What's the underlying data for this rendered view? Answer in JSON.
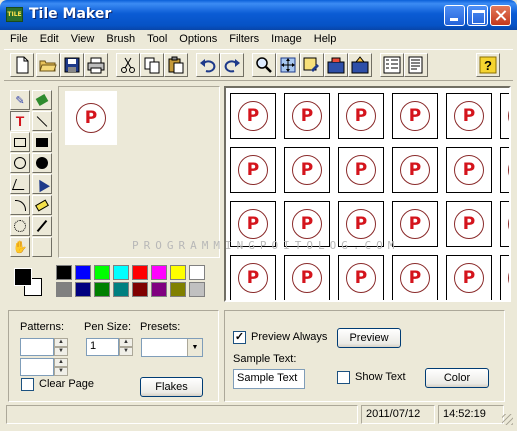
{
  "window": {
    "title": "Tile Maker",
    "icon_text": "TILE"
  },
  "menu": [
    "File",
    "Edit",
    "View",
    "Brush",
    "Tool",
    "Options",
    "Filters",
    "Image",
    "Help"
  ],
  "toolbar_icons": [
    "new-file-icon",
    "open-folder-icon",
    "save-icon",
    "print-icon",
    "cut-icon",
    "copy-icon",
    "paste-icon",
    "undo-icon",
    "redo-icon",
    "zoom-icon",
    "move-icon",
    "tile-edit-icon",
    "tile-fill-icon",
    "tile-export-icon",
    "grid-icon",
    "page-icon",
    "help-icon"
  ],
  "tools": [
    "pencil-tool",
    "fill-tool",
    "text-tool",
    "line-tool",
    "rectangle-tool",
    "filled-rectangle-tool",
    "ellipse-tool",
    "filled-ellipse-tool",
    "polygon-tool",
    "filled-polygon-tool",
    "curve-tool",
    "eraser-tool",
    "spray-tool",
    "eyedropper-tool",
    "hand-tool",
    "blank-tool"
  ],
  "tile": {
    "letter": "P"
  },
  "colors": {
    "foreground": "#000000",
    "background": "#FFFFFF",
    "palette": [
      "#000000",
      "#0000FF",
      "#00FF00",
      "#00FFFF",
      "#FF0000",
      "#FF00FF",
      "#FFFF00",
      "#FFFFFF",
      "#808080",
      "#000080",
      "#008000",
      "#008080",
      "#800000",
      "#800080",
      "#808000",
      "#C0C0C0"
    ],
    "accent_red": "#D4141C"
  },
  "watermark": "PROGRAMMINGPOITOLOG.COM",
  "left_options": {
    "patterns_label": "Patterns:",
    "pen_size_label": "Pen Size:",
    "pen_size_value": "1",
    "presets_label": "Presets:",
    "clear_page_label": "Clear Page",
    "flakes_button": "Flakes"
  },
  "right_options": {
    "preview_always_label": "Preview Always",
    "preview_always_checked": true,
    "preview_button": "Preview",
    "sample_text_label": "Sample Text:",
    "sample_text_value": "Sample Text",
    "show_text_label": "Show Text",
    "show_text_checked": false,
    "color_button": "Color"
  },
  "status": {
    "message": "",
    "date": "2011/07/12",
    "time": "14:52:19"
  }
}
